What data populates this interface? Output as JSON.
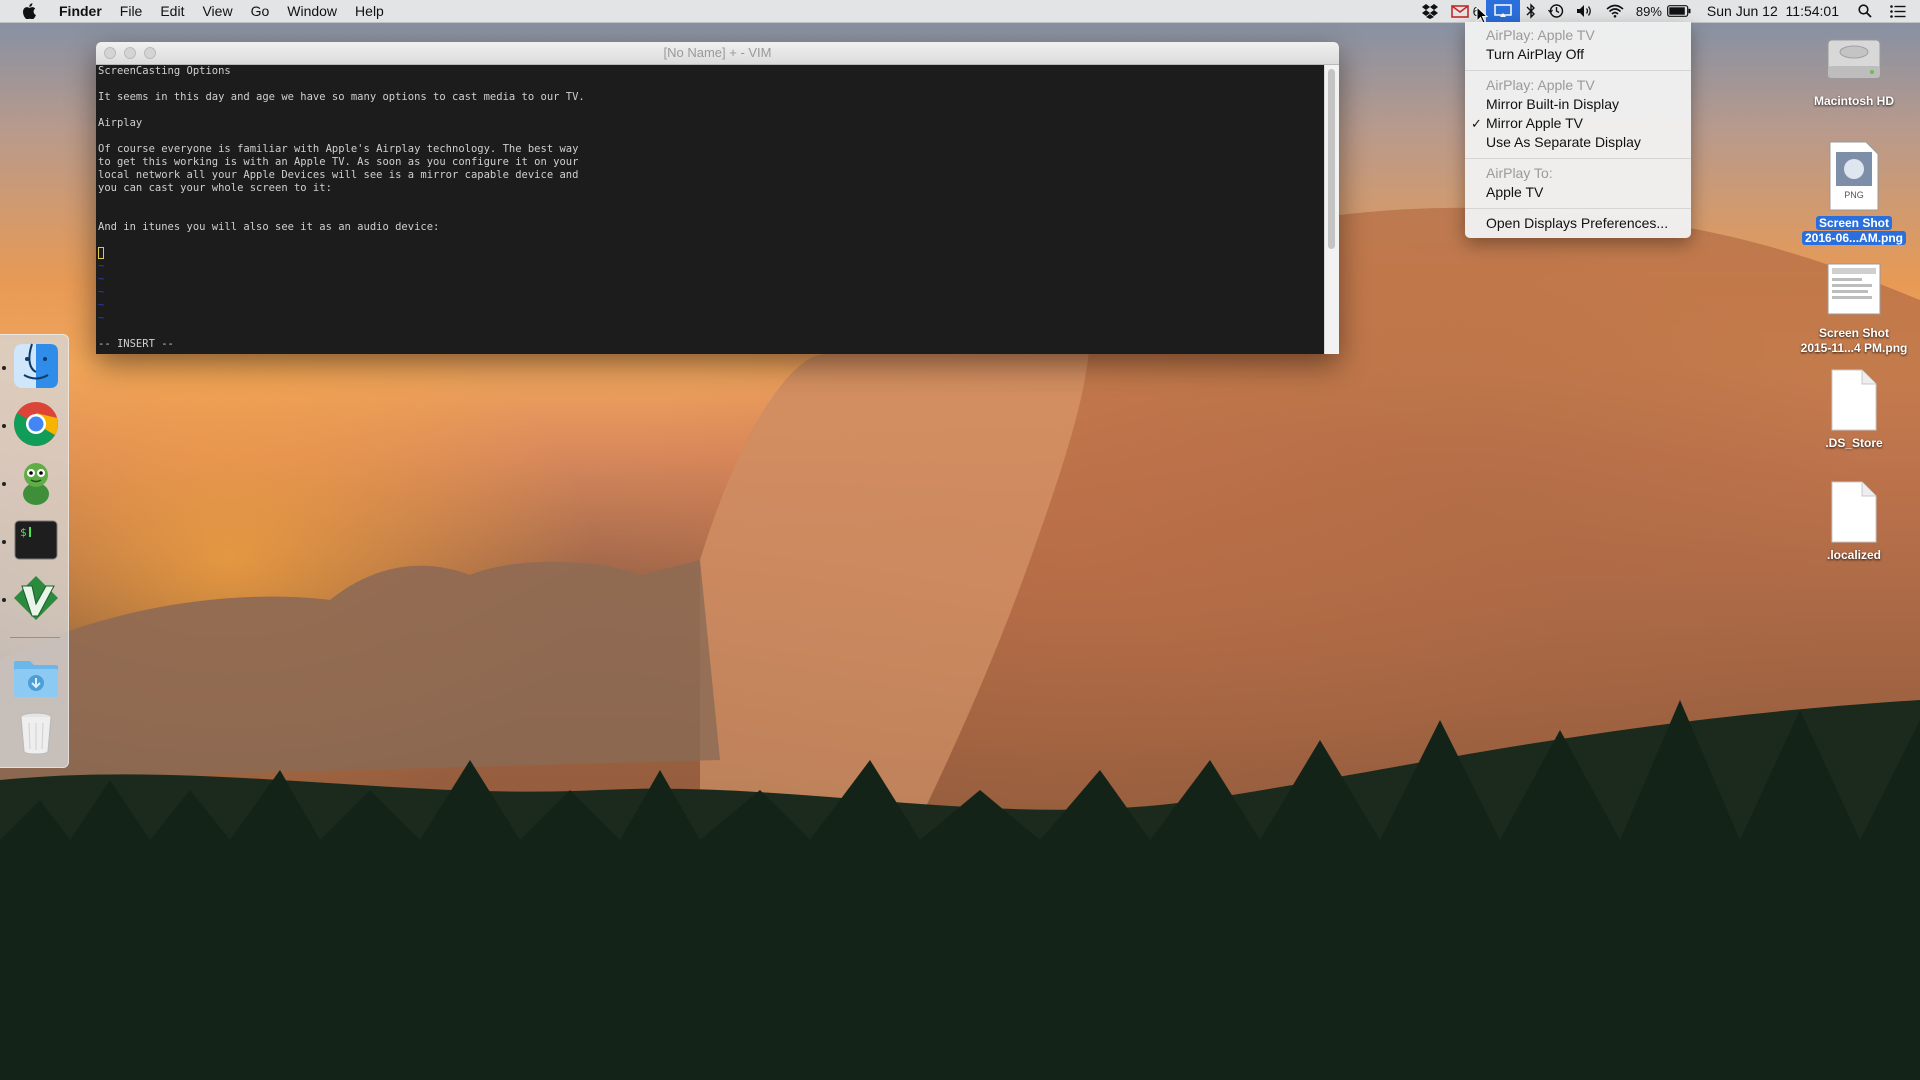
{
  "menubar": {
    "app_name": "Finder",
    "menus": [
      "File",
      "Edit",
      "View",
      "Go",
      "Window",
      "Help"
    ],
    "mail_count": "6",
    "battery": "89%",
    "datetime": "Sun Jun 12  11:54:01"
  },
  "airplay_menu": {
    "header1": "AirPlay: Apple TV",
    "turn_off": "Turn AirPlay Off",
    "header2": "AirPlay: Apple TV",
    "mirror_builtin": "Mirror Built-in Display",
    "mirror_apple_tv": "Mirror Apple TV",
    "separate_display": "Use As Separate Display",
    "header3": "AirPlay To:",
    "apple_tv": "Apple TV",
    "open_prefs": "Open Displays Preferences..."
  },
  "vim": {
    "title": "[No Name] + - VIM",
    "lines": [
      "ScreenCasting Options",
      "",
      "It seems in this day and age we have so many options to cast media to our TV.",
      "",
      "Airplay",
      "",
      "Of course everyone is familiar with Apple's Airplay technology. The best way",
      "to get this working is with an Apple TV. As soon as you configure it on your",
      "local network all your Apple Devices will see is a mirror capable device and",
      "you can cast your whole screen to it:",
      "",
      "",
      "And in itunes you will also see it as an audio device:"
    ],
    "mode": "-- INSERT --",
    "tilde": "~"
  },
  "desktop_icons": {
    "hd": "Macintosh HD",
    "shot1_line1": "Screen Shot",
    "shot1_line2": "2016-06...AM.png",
    "png_badge": "PNG",
    "shot2_line1": "Screen Shot",
    "shot2_line2": "2015-11...4 PM.png",
    "ds_store": ".DS_Store",
    "localized": ".localized"
  },
  "dock": {
    "apps": [
      "finder-icon",
      "chrome-icon",
      "adium-icon",
      "terminal-icon",
      "vim-icon",
      "downloads-folder-icon",
      "trash-icon"
    ]
  }
}
